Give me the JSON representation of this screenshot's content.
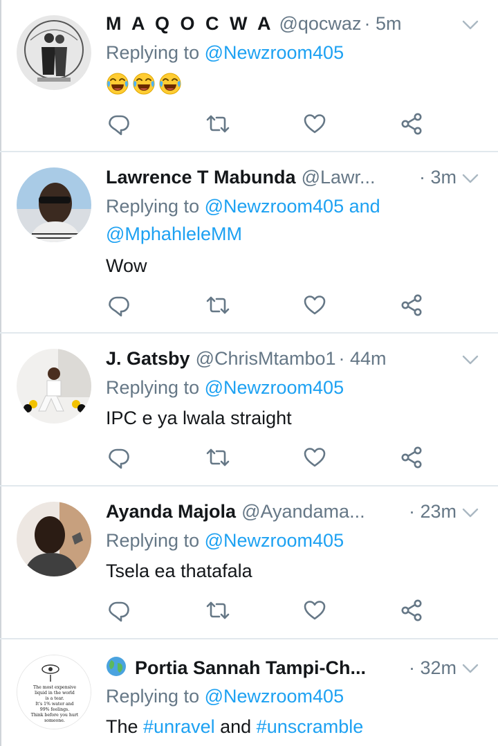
{
  "colors": {
    "accent": "#1da1f2",
    "muted": "#657786",
    "text": "#14171a",
    "divider": "#e1e8ed"
  },
  "tweets": [
    {
      "name": "M A Q O C W A",
      "handle": "@qocwaz",
      "time": "· 5m",
      "replying_prefix": "Replying to ",
      "replying_to": "@Newzroom405",
      "emojis": [
        "face-with-tears-of-joy",
        "face-with-tears-of-joy",
        "face-with-tears-of-joy"
      ]
    },
    {
      "name": "Lawrence T Mabunda",
      "handle": "@Lawr...",
      "time": "· 3m",
      "replying_prefix": "Replying to ",
      "replying_to": "@Newzroom405",
      "replying_and": " and",
      "replying_to_2": "@MphahleleMM",
      "text": "Wow"
    },
    {
      "name": "J. Gatsby",
      "handle": "@ChrisMtambo1",
      "time": "· 44m",
      "replying_prefix": "Replying to ",
      "replying_to": "@Newzroom405",
      "text": "IPC e ya lwala straight"
    },
    {
      "name": "Ayanda Majola",
      "handle": "@Ayandama...",
      "time": "· 23m",
      "replying_prefix": "Replying to ",
      "replying_to": "@Newzroom405",
      "text": "Tsela ea thatafala"
    },
    {
      "name": "Portia Sannah Tampi-Ch...",
      "name_icon": "globe-icon",
      "time": "· 32m",
      "replying_prefix": "Replying to ",
      "replying_to": "@Newzroom405",
      "text_prefix": "The ",
      "hashtag_1": "#unravel",
      "text_mid": " and ",
      "hashtag_2": "#unscramble",
      "avatar_text": [
        "The most expensive",
        "liquid in the world",
        "is a tear.",
        "It's 1% water and",
        "99% feelings.",
        "Think before you hurt",
        "someone."
      ]
    }
  ],
  "icons": {
    "reply": "reply-icon",
    "retweet": "retweet-icon",
    "like": "heart-icon",
    "share": "share-icon",
    "more": "chevron-down-icon"
  }
}
